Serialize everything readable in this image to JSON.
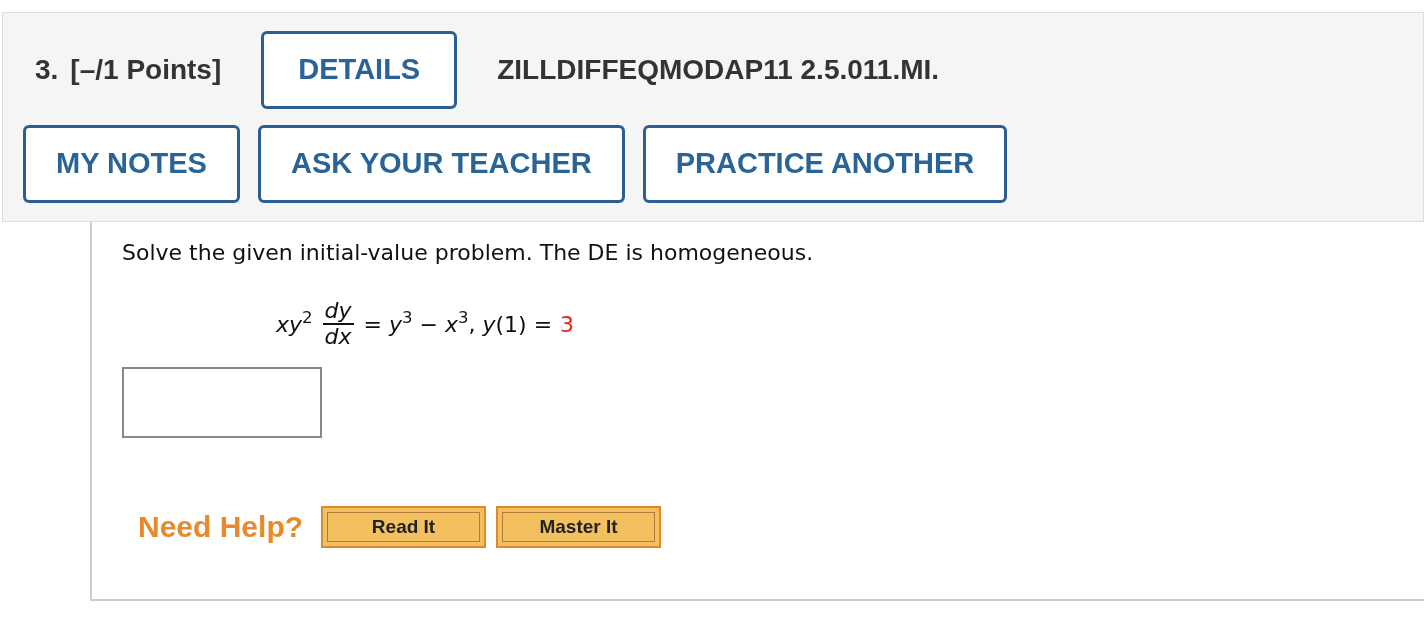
{
  "question": {
    "number": "3.",
    "points": "[–/1 Points]",
    "details_button": "DETAILS",
    "code": "ZILLDIFFEQMODAP11 2.5.011.MI."
  },
  "actions": [
    "MY NOTES",
    "ASK YOUR TEACHER",
    "PRACTICE ANOTHER"
  ],
  "problem": {
    "prompt": "Solve the given initial-value problem. The DE is homogeneous.",
    "equation": {
      "lhs": "*xy*$^{2}$",
      "numerator": "*dy*",
      "denominator": "*dx*",
      "rhs": "= *y*$^{3}$ − *x*$^{3}$, *y*(1) =",
      "given_value": "3"
    }
  },
  "help": {
    "label": "Need Help?",
    "buttons": [
      "Read It",
      "Master It"
    ]
  }
}
